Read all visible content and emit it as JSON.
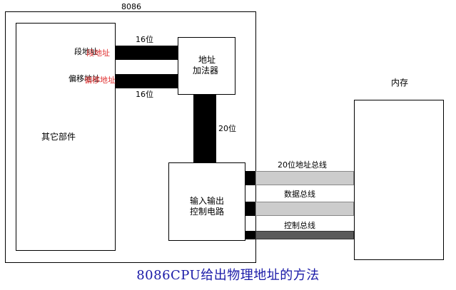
{
  "cpu": {
    "title": "8086"
  },
  "other_parts": {
    "label": "其它部件"
  },
  "adder": {
    "line1": "地址",
    "line2": "加法器"
  },
  "segment": {
    "label": "段地址",
    "overlay": "段地址"
  },
  "offset": {
    "label": "偏移地址",
    "overlay": "偏移地址"
  },
  "bus16_top": {
    "label": "16位"
  },
  "bus16_bottom": {
    "label": "16位"
  },
  "bus20": {
    "label": "20位"
  },
  "io": {
    "line1": "输入输出",
    "line2": "控制电路"
  },
  "memory": {
    "label": "内存"
  },
  "buses": {
    "address": "20位地址总线",
    "data": "数据总线",
    "control": "控制总线"
  },
  "caption": "8086CPU给出物理地址的方法",
  "colors": {
    "bus_fill": "#cccccc",
    "control_fill": "#5a5a5a",
    "caption": "#1a1aa8",
    "overlay_text": "#e03030"
  }
}
